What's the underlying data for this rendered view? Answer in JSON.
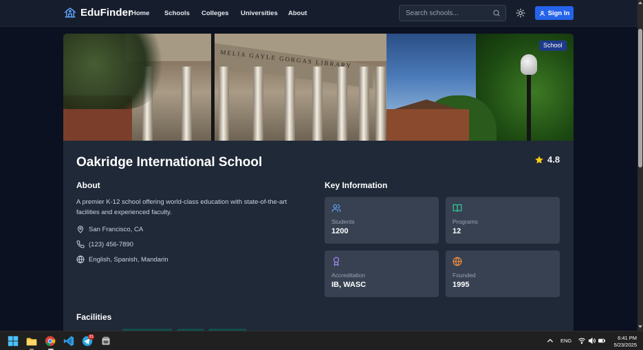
{
  "nav": {
    "brand": "EduFinder",
    "links": [
      "Home",
      "Schools",
      "Colleges",
      "Universities",
      "About"
    ],
    "search_placeholder": "Search schools...",
    "signin_label": "Sign In"
  },
  "hero": {
    "badge": "School",
    "engraving": "MELIA GAYLE GORGAS LIBRARY"
  },
  "school": {
    "name": "Oakridge International School",
    "rating": "4.8"
  },
  "about": {
    "title": "About",
    "description": "A premier K-12 school offering world-class education with state-of-the-art facilities and experienced faculty.",
    "location": "San Francisco, CA",
    "phone": "(123) 456-7890",
    "languages": "English, Spanish, Mandarin"
  },
  "key_info": {
    "title": "Key Information",
    "stats": [
      {
        "label": "Students",
        "value": "1200",
        "icon": "users-icon",
        "color": "#60a5fa"
      },
      {
        "label": "Programs",
        "value": "12",
        "icon": "book-icon",
        "color": "#34d399"
      },
      {
        "label": "Accreditation",
        "value": "IB, WASC",
        "icon": "award-icon",
        "color": "#a78bfa"
      },
      {
        "label": "Founded",
        "value": "1995",
        "icon": "globe-icon",
        "color": "#fb923c"
      }
    ]
  },
  "facilities": {
    "title": "Facilities"
  },
  "taskbar": {
    "language": "ENG",
    "time": "6:41 PM",
    "date": "5/23/2025",
    "telegram_badge": "33"
  },
  "colors": {
    "accent": "#2563eb",
    "star": "#facc15",
    "badge": "#1e3a8a"
  }
}
